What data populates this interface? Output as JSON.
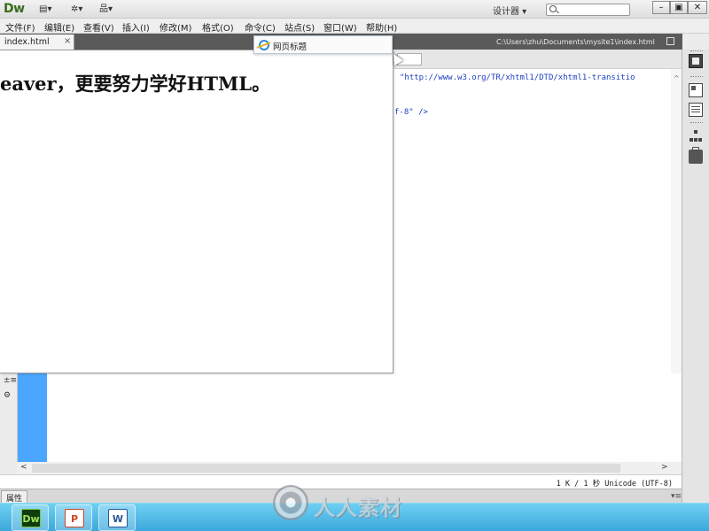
{
  "app": {
    "logo_text": "Dw",
    "workspace_label": "设计器 ▾",
    "toolbar_icons": [
      "layout-icon",
      "gear-icon",
      "site-icon"
    ]
  },
  "window_controls": {
    "minimize": "–",
    "restore": "▣",
    "close": "✕"
  },
  "menubar": {
    "items": [
      {
        "label": "文件(F)"
      },
      {
        "label": "编辑(E)"
      },
      {
        "label": "查看(V)"
      },
      {
        "label": "插入(I)"
      },
      {
        "label": "修改(M)"
      },
      {
        "label": "格式(O)"
      },
      {
        "label": "命令(C)"
      },
      {
        "label": "站点(S)"
      },
      {
        "label": "窗口(W)"
      },
      {
        "label": "帮助(H)"
      }
    ]
  },
  "document": {
    "tab_label": "index.html",
    "tab_close": "×",
    "file_path": "C:\\Users\\zhu\\Documents\\mysite1\\index.html"
  },
  "browser_preview": {
    "tab_title": "网页标题",
    "visible_text": "eaver，更要努力学好HTML。"
  },
  "code_view": {
    "line1": "\"http://www.w3.org/TR/xhtml1/DTD/xhtml1-transitio",
    "line2": "f-8\" />"
  },
  "scroll": {
    "left": "<",
    "right": ">",
    "up": "^",
    "down": "v"
  },
  "status_bar": {
    "text": "1 K / 1 秒  Unicode (UTF-8)"
  },
  "properties_panel": {
    "tab_label": "属性",
    "menu_glyph": "▾≡"
  },
  "taskbar": {
    "apps": [
      {
        "label": "Dw",
        "name": "dreamweaver"
      },
      {
        "label": "P",
        "name": "powerpoint"
      },
      {
        "label": "W",
        "name": "word"
      }
    ]
  },
  "watermark": {
    "text": "人人素材"
  },
  "colors": {
    "code_blue": "#1c3fbf",
    "design_strip_blue": "#4aa6ff",
    "taskbar": "#3ba7dc",
    "dw_green": "#9fe35a"
  }
}
